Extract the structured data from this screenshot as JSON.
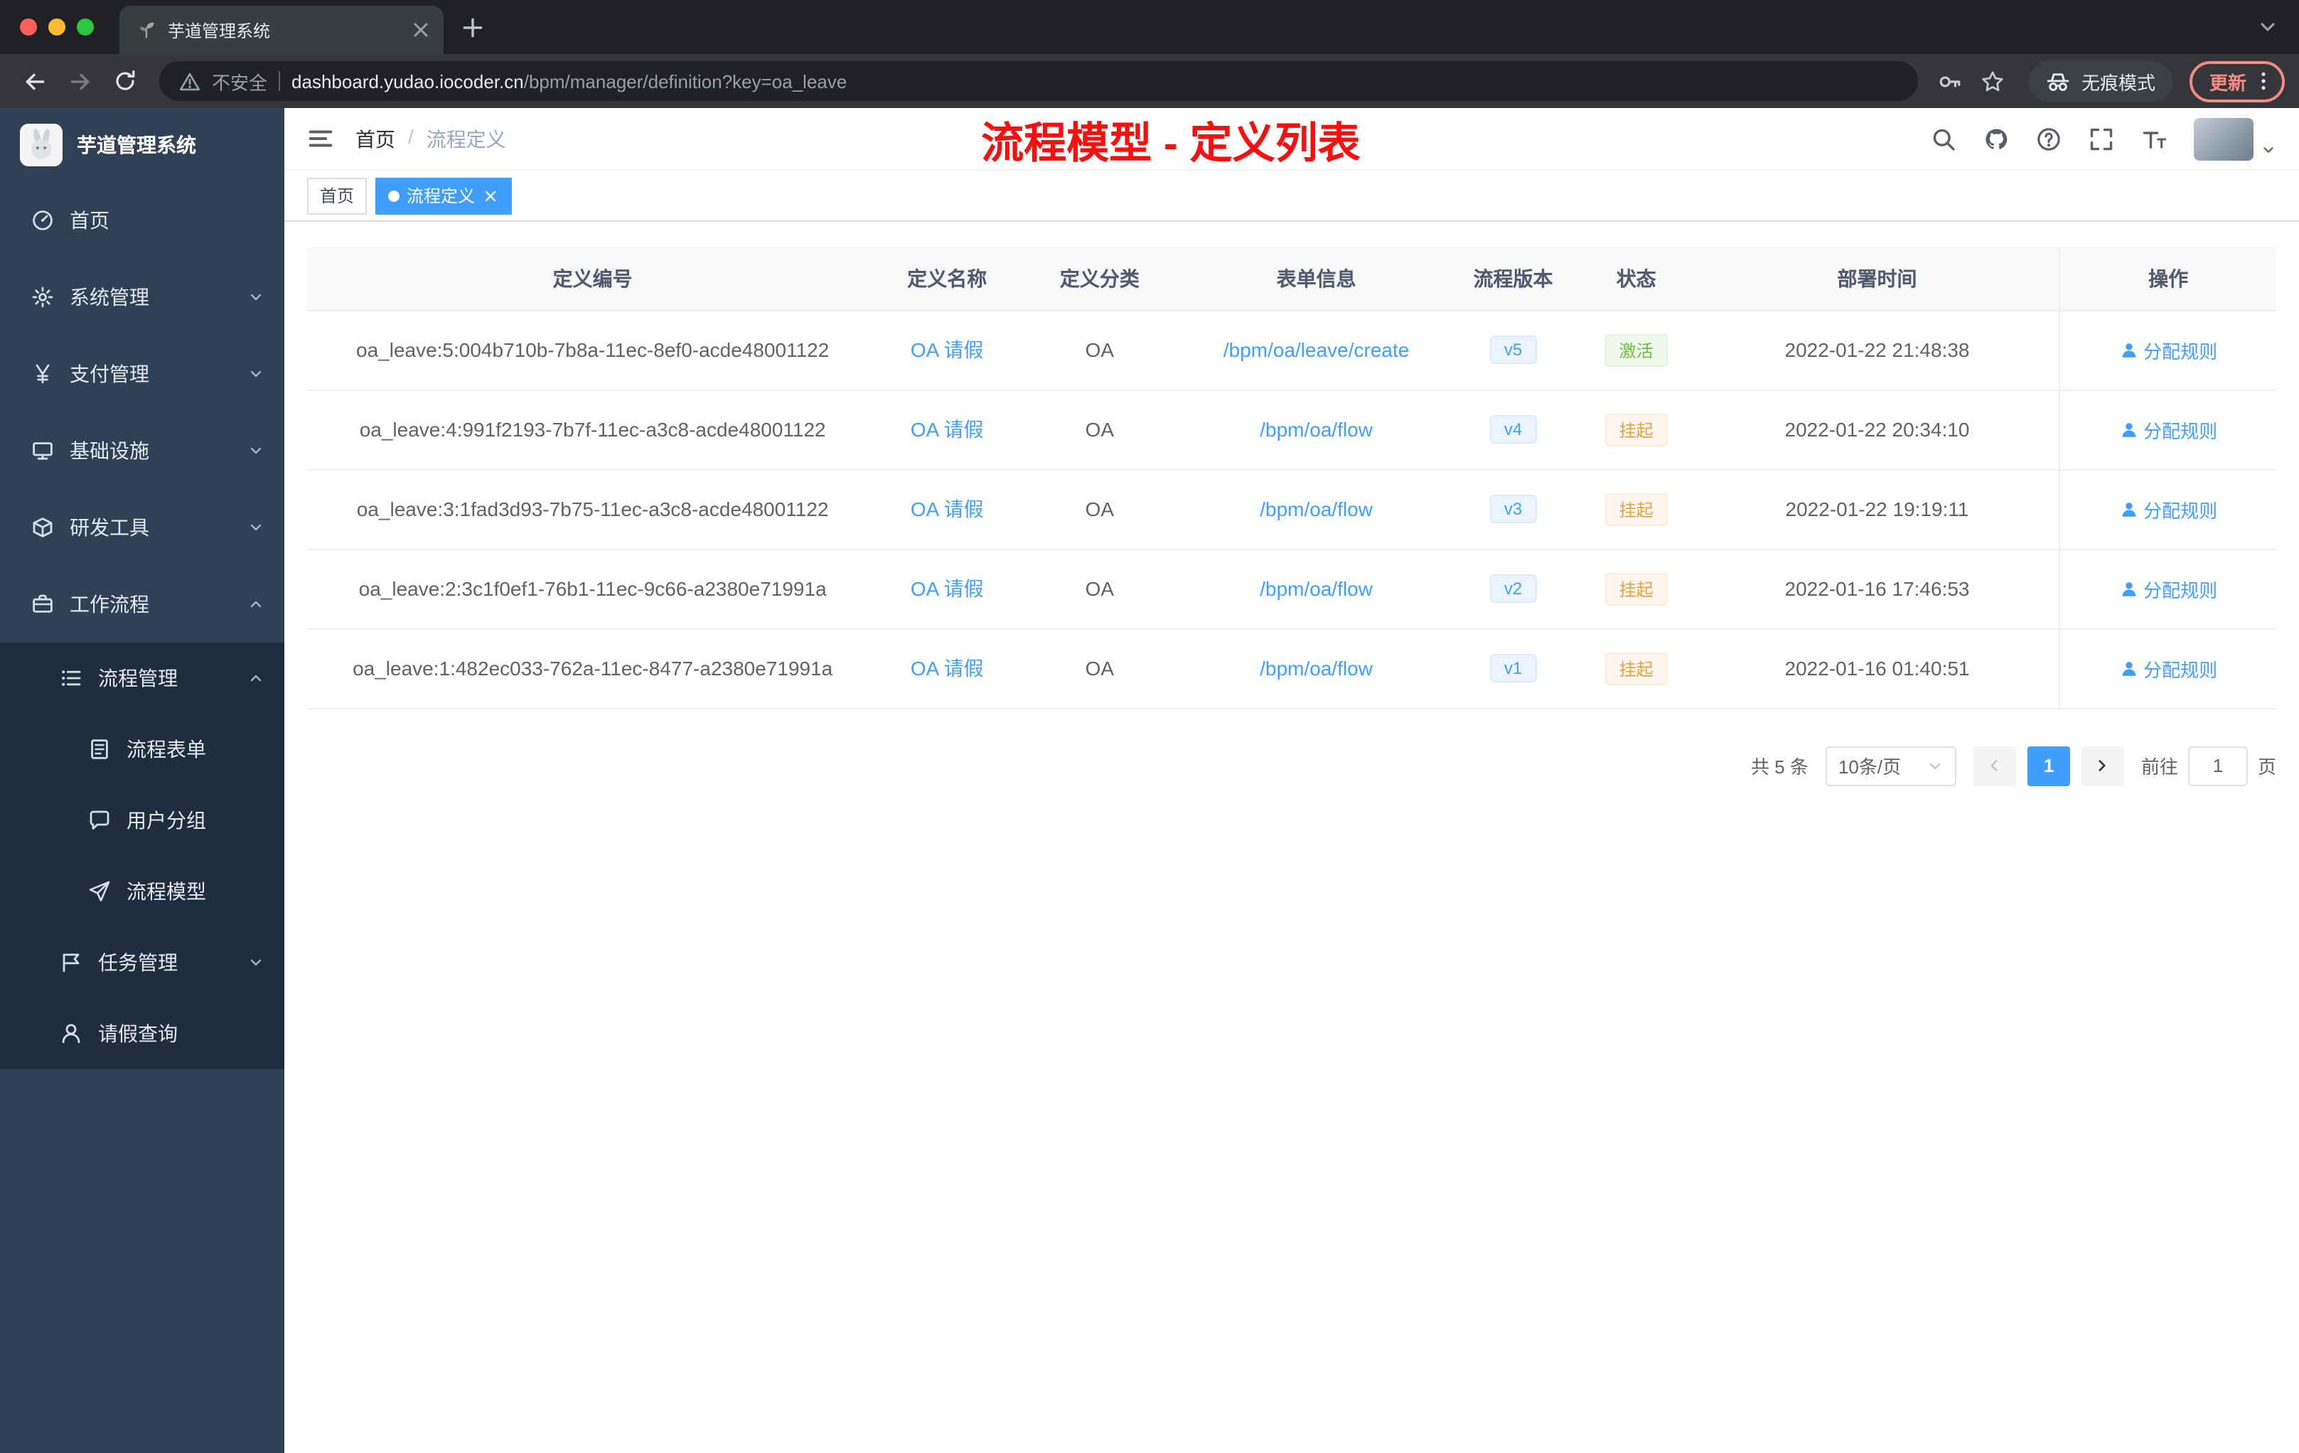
{
  "browser": {
    "tab": {
      "title": "芋道管理系统"
    },
    "toolbar": {
      "security_label": "不安全",
      "url_host": "dashboard.yudao.iocoder.cn",
      "url_path": "/bpm/manager/definition?key=oa_leave",
      "incognito_label": "无痕模式",
      "update_label": "更新"
    }
  },
  "sidebar": {
    "app_title": "芋道管理系统",
    "items": [
      {
        "label": "首页",
        "icon": "dashboard",
        "level": "lvl1",
        "arrow": ""
      },
      {
        "label": "系统管理",
        "icon": "gear",
        "level": "lvl1",
        "arrow": "down"
      },
      {
        "label": "支付管理",
        "icon": "yen",
        "level": "lvl1",
        "arrow": "down"
      },
      {
        "label": "基础设施",
        "icon": "monitor",
        "level": "lvl1",
        "arrow": "down"
      },
      {
        "label": "研发工具",
        "icon": "box",
        "level": "lvl1",
        "arrow": "down"
      },
      {
        "label": "工作流程",
        "icon": "briefcase",
        "level": "lvl1",
        "arrow": "up"
      },
      {
        "label": "流程管理",
        "icon": "list",
        "level": "lvl2",
        "arrow": "up"
      },
      {
        "label": "流程表单",
        "icon": "form",
        "level": "lvl3",
        "arrow": ""
      },
      {
        "label": "用户分组",
        "icon": "chat",
        "level": "lvl3",
        "arrow": ""
      },
      {
        "label": "流程模型",
        "icon": "send",
        "level": "lvl3",
        "arrow": ""
      },
      {
        "label": "任务管理",
        "icon": "task",
        "level": "lvl2",
        "arrow": "down"
      },
      {
        "label": "请假查询",
        "icon": "user",
        "level": "lvl2",
        "arrow": ""
      }
    ]
  },
  "header": {
    "breadcrumb": {
      "home": "首页",
      "sep": "/",
      "current": "流程定义"
    },
    "annotation": "流程模型 - 定义列表"
  },
  "tagsbar": {
    "home": "首页",
    "active": "流程定义"
  },
  "table": {
    "headers": [
      "定义编号",
      "定义名称",
      "定义分类",
      "表单信息",
      "流程版本",
      "状态",
      "部署时间",
      "操作"
    ],
    "rows": [
      {
        "id": "oa_leave:5:004b710b-7b8a-11ec-8ef0-acde48001122",
        "name": "OA 请假",
        "category": "OA",
        "form": "/bpm/oa/leave/create",
        "version": "v5",
        "status": "激活",
        "status_type": "success",
        "deployed": "2022-01-22 21:48:38",
        "action": "分配规则"
      },
      {
        "id": "oa_leave:4:991f2193-7b7f-11ec-a3c8-acde48001122",
        "name": "OA 请假",
        "category": "OA",
        "form": "/bpm/oa/flow",
        "version": "v4",
        "status": "挂起",
        "status_type": "warning",
        "deployed": "2022-01-22 20:34:10",
        "action": "分配规则"
      },
      {
        "id": "oa_leave:3:1fad3d93-7b75-11ec-a3c8-acde48001122",
        "name": "OA 请假",
        "category": "OA",
        "form": "/bpm/oa/flow",
        "version": "v3",
        "status": "挂起",
        "status_type": "warning",
        "deployed": "2022-01-22 19:19:11",
        "action": "分配规则"
      },
      {
        "id": "oa_leave:2:3c1f0ef1-76b1-11ec-9c66-a2380e71991a",
        "name": "OA 请假",
        "category": "OA",
        "form": "/bpm/oa/flow",
        "version": "v2",
        "status": "挂起",
        "status_type": "warning",
        "deployed": "2022-01-16 17:46:53",
        "action": "分配规则"
      },
      {
        "id": "oa_leave:1:482ec033-762a-11ec-8477-a2380e71991a",
        "name": "OA 请假",
        "category": "OA",
        "form": "/bpm/oa/flow",
        "version": "v1",
        "status": "挂起",
        "status_type": "warning",
        "deployed": "2022-01-16 01:40:51",
        "action": "分配规则"
      }
    ]
  },
  "pagination": {
    "total": "共 5 条",
    "page_size": "10条/页",
    "current": "1",
    "goto_label": "前往",
    "goto_value": "1",
    "page_label": "页"
  },
  "colors": {
    "accent": "#409eff",
    "success": "#67c23a",
    "warning": "#e6a23c",
    "annotation": "#fb0e0e"
  }
}
